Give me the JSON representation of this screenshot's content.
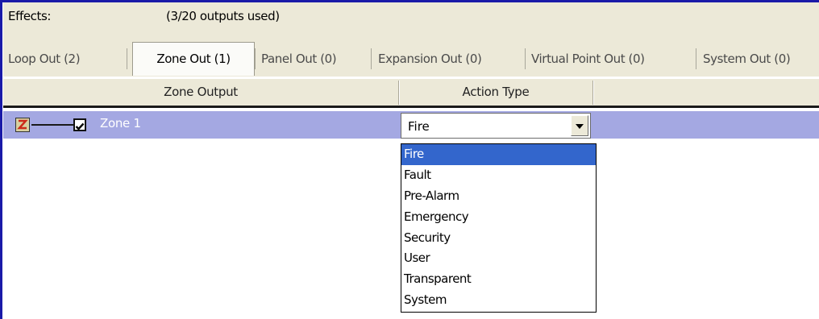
{
  "effects": {
    "label": "Effects:",
    "outputs_used": "(3/20 outputs used)"
  },
  "tabs": [
    {
      "label": "Loop Out (2)"
    },
    {
      "label": "Zone Out (1)",
      "active": true
    },
    {
      "label": "Panel Out (0)"
    },
    {
      "label": "Expansion Out (0)"
    },
    {
      "label": "Virtual Point Out (0)"
    },
    {
      "label": "System Out (0)"
    }
  ],
  "grid": {
    "columns": [
      "Zone Output",
      "Action Type"
    ],
    "rows": [
      {
        "zone_label": "Zone 1",
        "checked": true,
        "action": "Fire"
      }
    ]
  },
  "dropdown": {
    "selected": "Fire",
    "options": [
      "Fire",
      "Fault",
      "Pre-Alarm",
      "Emergency",
      "Security",
      "User",
      "Transparent",
      "System"
    ]
  },
  "colors": {
    "frame_border": "#1a1aa8",
    "row_highlight": "#a4a8e2",
    "option_selected": "#3366cc"
  }
}
